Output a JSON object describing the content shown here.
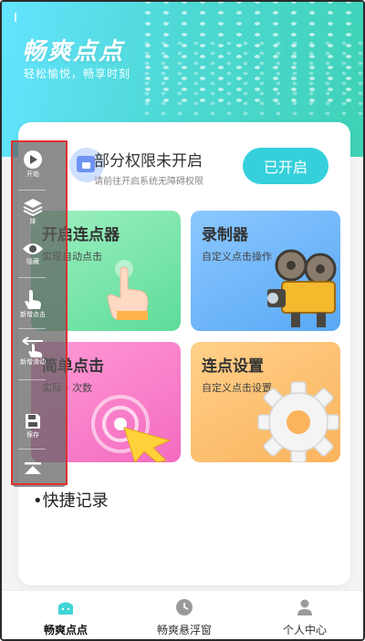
{
  "header": {
    "title": "畅爽点点",
    "subtitle": "轻松愉悦，畅享时刻"
  },
  "permission": {
    "title": "部分权限未开启",
    "description": "请前往开启系统无障碍权限",
    "button_label": "已开启"
  },
  "features": [
    {
      "title": "开启连点器",
      "subtitle": "实现自动点击",
      "icon": "pointing-hand-icon",
      "color": "#5ddc9a"
    },
    {
      "title": "录制器",
      "subtitle": "自定义点击操作",
      "icon": "film-camera-icon",
      "color": "#58a8f5"
    },
    {
      "title": "简单点击",
      "subtitle": "实际 - 次数",
      "icon": "target-cursor-icon",
      "color": "#f36bc0"
    },
    {
      "title": "连点设置",
      "subtitle": "自定义点击设置",
      "icon": "gear-icon",
      "color": "#fbb35c"
    }
  ],
  "quick_record": {
    "label": "快捷记录"
  },
  "float_toolbar": {
    "items": [
      {
        "label": "开始",
        "icon": "play-icon"
      },
      {
        "label": "排",
        "icon": "layers-icon"
      },
      {
        "label": "隐藏",
        "icon": "eye-icon"
      },
      {
        "label": "新增点击",
        "icon": "tap-icon"
      },
      {
        "label": "新增滑动",
        "icon": "swipe-icon"
      },
      {
        "label": "保存",
        "icon": "save-icon"
      },
      {
        "label": "",
        "icon": "collapse-icon"
      }
    ]
  },
  "tabbar": {
    "tabs": [
      {
        "label": "畅爽点点",
        "icon": "home-icon",
        "active": true
      },
      {
        "label": "畅爽悬浮窗",
        "icon": "clock-icon",
        "active": false
      },
      {
        "label": "个人中心",
        "icon": "user-icon",
        "active": false
      }
    ]
  },
  "colors": {
    "accent": "#35d0dc",
    "highlight_border": "#e0312e"
  }
}
